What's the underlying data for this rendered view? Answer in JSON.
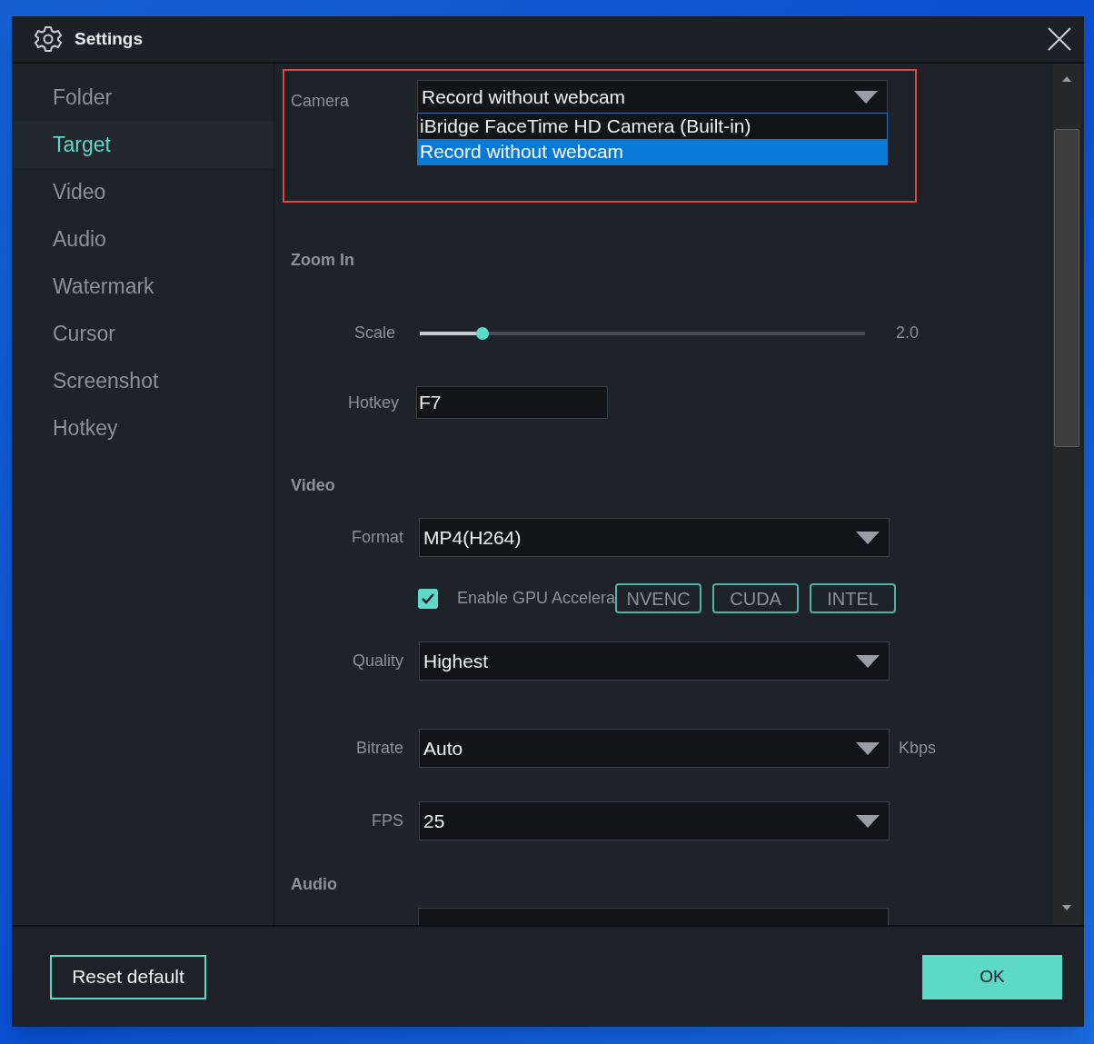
{
  "window": {
    "title": "Settings"
  },
  "sidebar": {
    "items": [
      {
        "label": "Folder",
        "selected": false
      },
      {
        "label": "Target",
        "selected": true
      },
      {
        "label": "Video",
        "selected": false
      },
      {
        "label": "Audio",
        "selected": false
      },
      {
        "label": "Watermark",
        "selected": false
      },
      {
        "label": "Cursor",
        "selected": false
      },
      {
        "label": "Screenshot",
        "selected": false
      },
      {
        "label": "Hotkey",
        "selected": false
      }
    ]
  },
  "camera": {
    "label": "Camera",
    "value": "Record without webcam",
    "expanded": true,
    "options": [
      {
        "label": "iBridge FaceTime HD Camera (Built-in)",
        "selected": false
      },
      {
        "label": "Record without webcam",
        "selected": true
      }
    ]
  },
  "zoom_in": {
    "heading": "Zoom In",
    "scale": {
      "label": "Scale",
      "level": 0.14,
      "reading": "2.0"
    },
    "hotkey": {
      "label": "Hotkey",
      "value": "F7"
    }
  },
  "video": {
    "heading": "Video",
    "format": {
      "label": "Format",
      "value": "MP4(H264)"
    },
    "gpu": {
      "label": "Enable GPU Accelera",
      "checked": true,
      "options": [
        "NVENC",
        "CUDA",
        "INTEL"
      ]
    },
    "quality": {
      "label": "Quality",
      "value": "Highest"
    },
    "bitrate": {
      "label": "Bitrate",
      "value": "Auto",
      "unit": "Kbps"
    },
    "fps": {
      "label": "FPS",
      "value": "25"
    }
  },
  "audio": {
    "heading": "Audio"
  },
  "footer": {
    "reset": "Reset default",
    "ok": "OK"
  }
}
